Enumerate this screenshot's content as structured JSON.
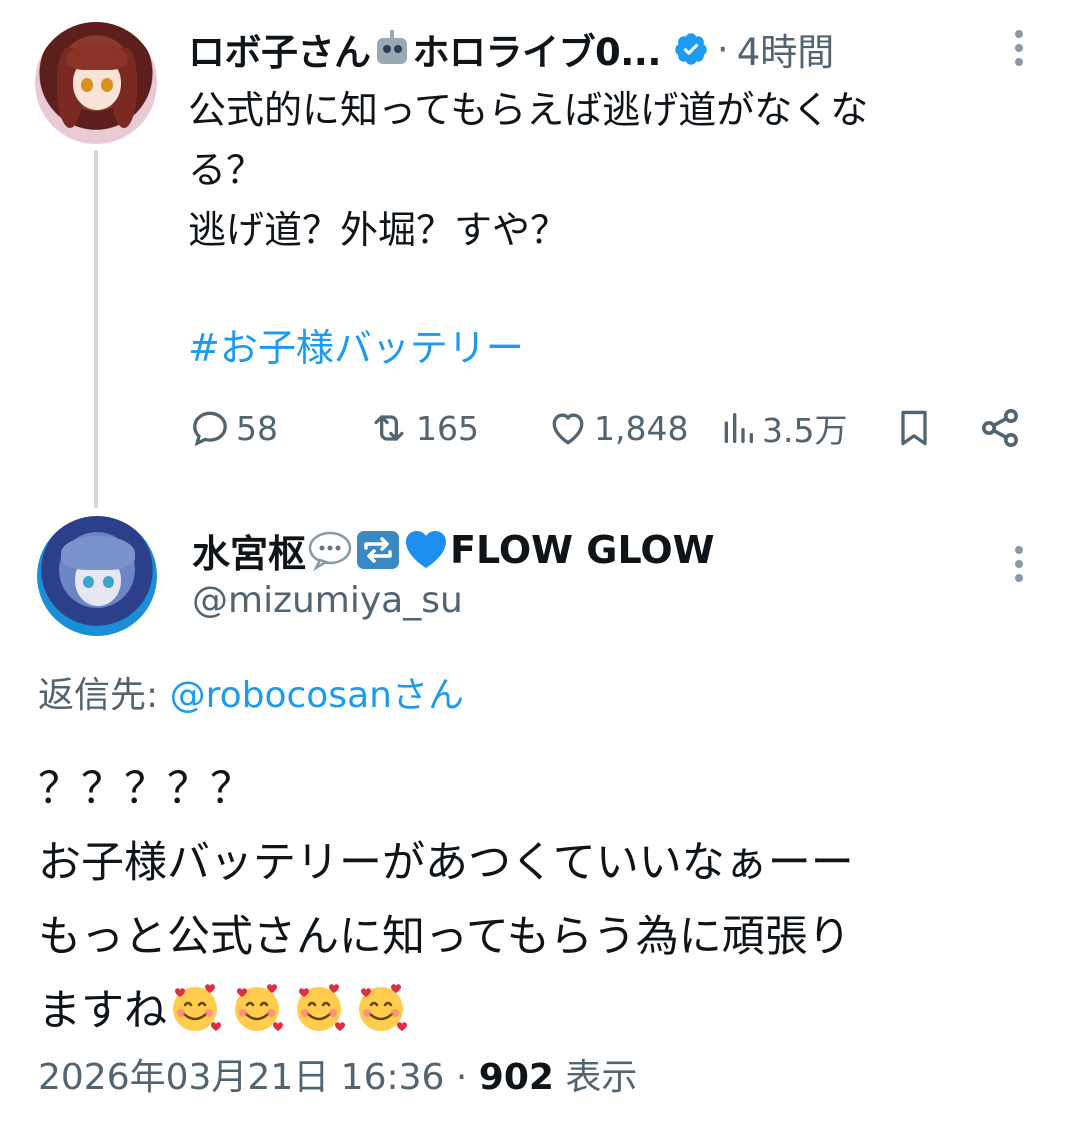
{
  "parent_tweet": {
    "display_name_part1": "ロボ子さん",
    "display_name_part2": "ホロライブ0...",
    "verified_icon": "verified-badge-icon",
    "separator": "·",
    "time_ago": "4時間",
    "lines": [
      "公式的に知ってもらえば逃げ道がなくな",
      "る？",
      "逃げ道？外堀？すや？"
    ],
    "hashtag": "#お子様バッテリー",
    "actions": {
      "replies": "58",
      "retweets": "165",
      "likes": "1,848",
      "views": "3.5万"
    }
  },
  "reply_tweet": {
    "display_name": "水宮枢",
    "display_name_suffix": "FLOW GLOW",
    "handle": "@mizumiya_su",
    "reply_to_label": "返信先: ",
    "reply_to_mention": "@robocosanさん",
    "lines": [
      "？？？？？",
      "お子様バッテリーがあつくていいなぁーー",
      "もっと公式さんに知ってもらう為に頑張り",
      "ますね"
    ],
    "timestamp": "2026年03月21日 16:36",
    "separator": " · ",
    "view_count": "902",
    "view_label": " 表示"
  },
  "colors": {
    "accent": "#1d9bf0",
    "secondary_text": "#536471",
    "thread_line": "#cfd9de"
  }
}
